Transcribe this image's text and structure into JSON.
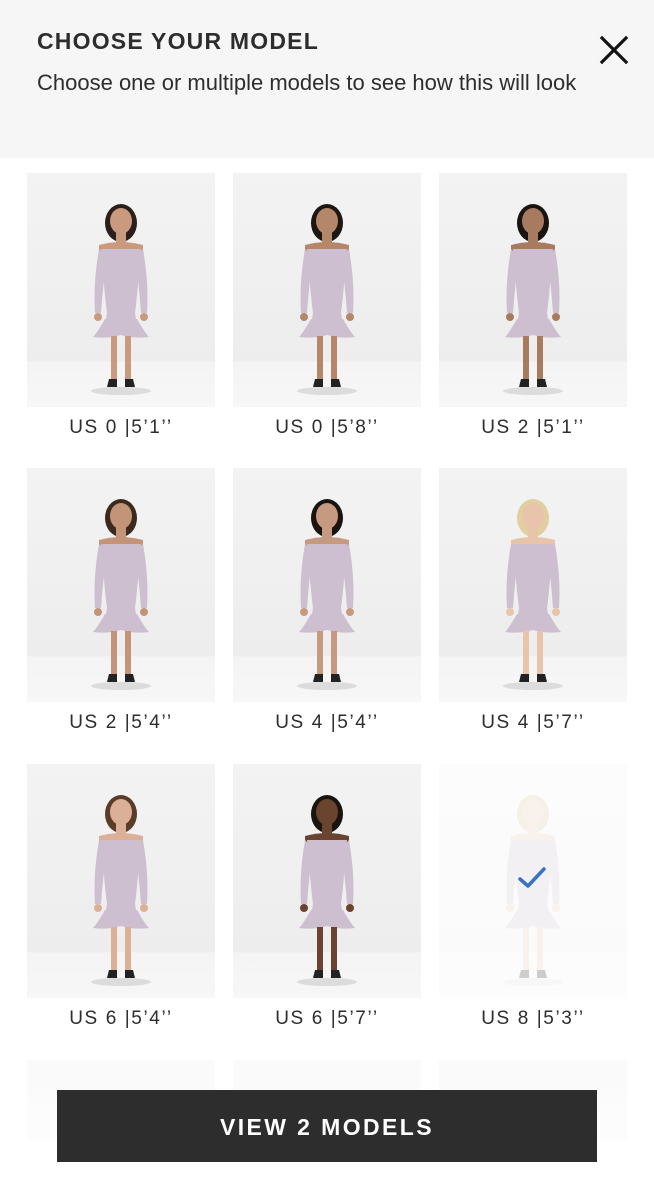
{
  "header": {
    "title": "CHOOSE YOUR MODEL",
    "subtitle": "Choose one or multiple models to see how this will look",
    "close_icon": "close-icon"
  },
  "models": [
    {
      "label": "US 0 |5’1’’",
      "hair": "#2a1f1a",
      "skin": "#c99a7e",
      "selected": false
    },
    {
      "label": "US 0 |5’8’’",
      "hair": "#1e1612",
      "skin": "#b5876a",
      "selected": false
    },
    {
      "label": "US 2 |5’1’’",
      "hair": "#1a1410",
      "skin": "#a87a60",
      "selected": false
    },
    {
      "label": "US 2 |5’4’’",
      "hair": "#3b2a1e",
      "skin": "#c49479",
      "selected": false
    },
    {
      "label": "US 4 |5’4’’",
      "hair": "#1a1410",
      "skin": "#c59a80",
      "selected": false
    },
    {
      "label": "US 4 |5’7’’",
      "hair": "#e2cfa0",
      "skin": "#e8c4aa",
      "selected": false
    },
    {
      "label": "US 6 |5’4’’",
      "hair": "#5a3c28",
      "skin": "#dcb096",
      "selected": false
    },
    {
      "label": "US 6 |5’7’’",
      "hair": "#1a1410",
      "skin": "#6b4430",
      "selected": false
    },
    {
      "label": "US 8 |5’3’’",
      "hair": "#d9c394",
      "skin": "#e6c3a8",
      "selected": true
    }
  ],
  "dress_color": "#cdbfd0",
  "check_color": "#3a72c4",
  "cta": {
    "label": "VIEW 2 MODELS"
  }
}
